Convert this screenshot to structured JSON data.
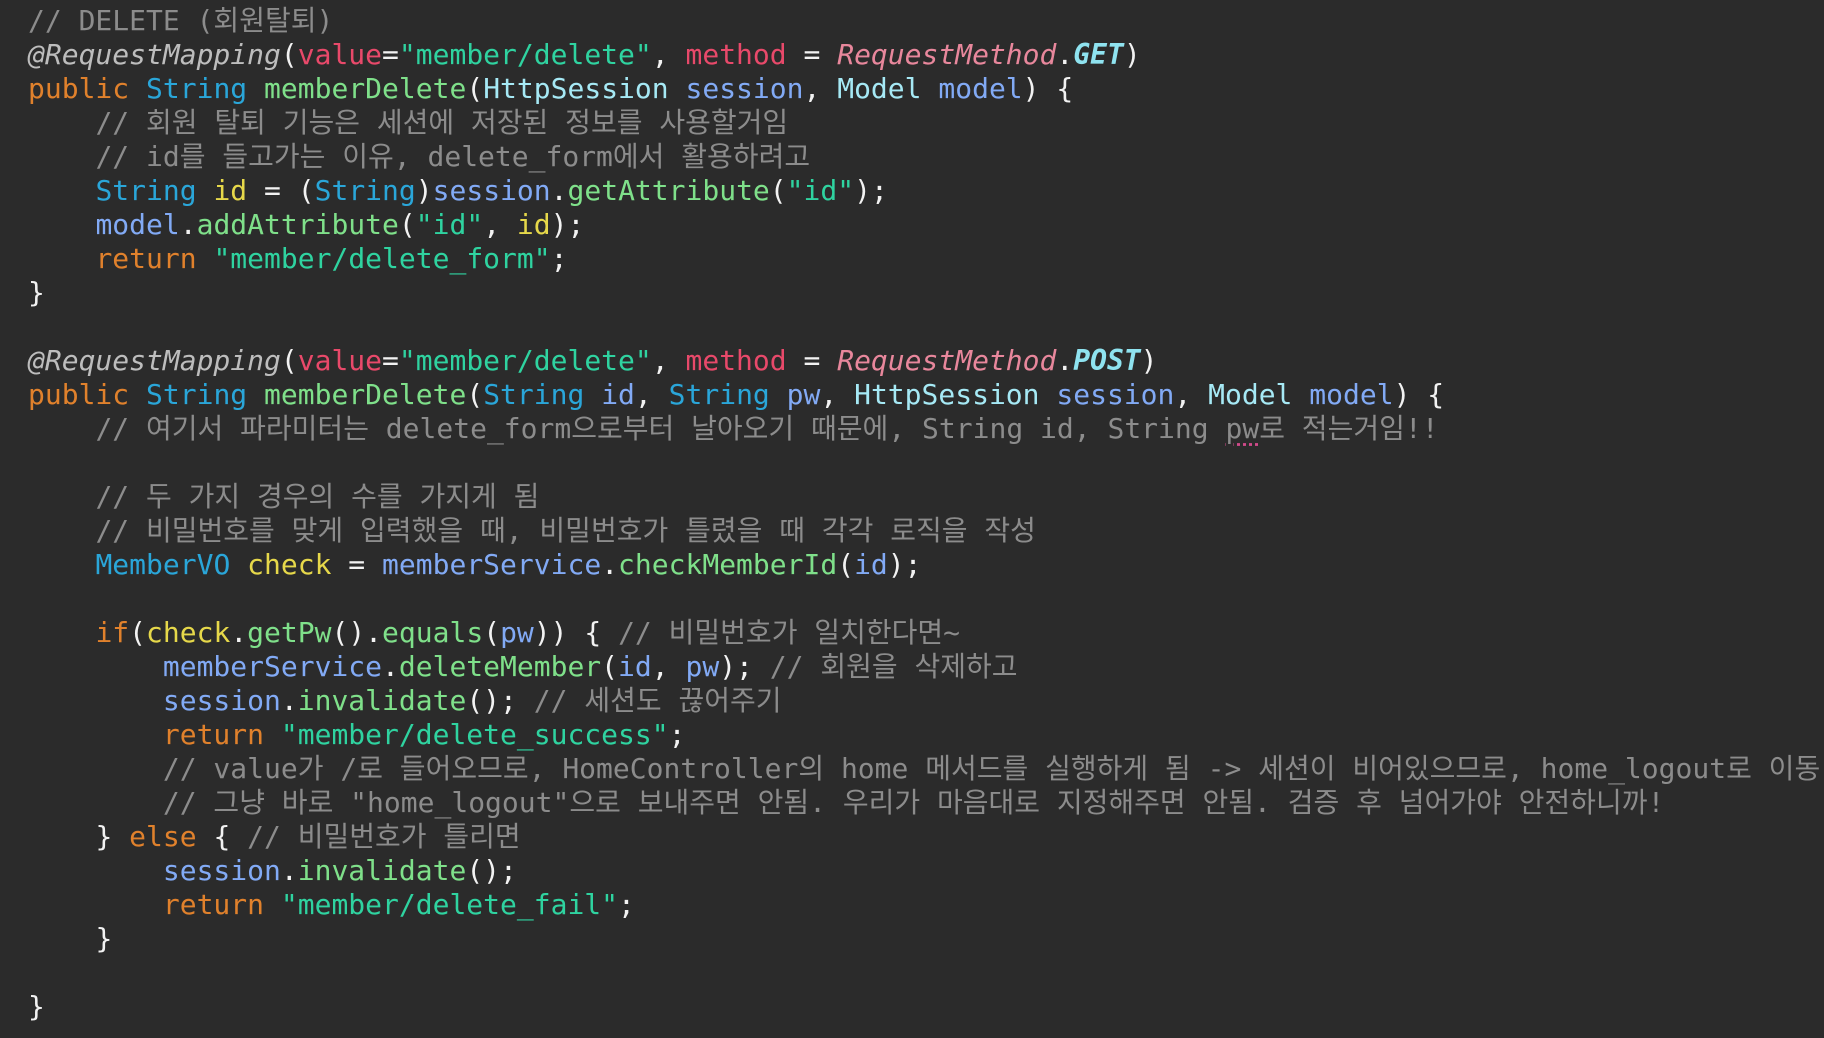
{
  "editor": {
    "lines": [
      [
        {
          "t": "// DELETE (회원탈퇴)",
          "c": "comment"
        }
      ],
      [
        {
          "t": "@RequestMapping",
          "c": "anno"
        },
        {
          "t": "(",
          "c": "punct"
        },
        {
          "t": "value",
          "c": "attr"
        },
        {
          "t": "=",
          "c": "punct"
        },
        {
          "t": "\"member/delete\"",
          "c": "string"
        },
        {
          "t": ", ",
          "c": "punct"
        },
        {
          "t": "method",
          "c": "attr"
        },
        {
          "t": " = ",
          "c": "punct"
        },
        {
          "t": "RequestMethod",
          "c": "enumCls"
        },
        {
          "t": ".",
          "c": "punct"
        },
        {
          "t": "GET",
          "c": "enumVal"
        },
        {
          "t": ")",
          "c": "punct"
        }
      ],
      [
        {
          "t": "public ",
          "c": "keyword"
        },
        {
          "t": "String ",
          "c": "type"
        },
        {
          "t": "memberDelete",
          "c": "method"
        },
        {
          "t": "(",
          "c": "punct"
        },
        {
          "t": "HttpSession ",
          "c": "typeLight"
        },
        {
          "t": "session",
          "c": "var"
        },
        {
          "t": ", ",
          "c": "punct"
        },
        {
          "t": "Model ",
          "c": "typeLight"
        },
        {
          "t": "model",
          "c": "var"
        },
        {
          "t": ") {",
          "c": "punct"
        }
      ],
      [
        {
          "t": "    ",
          "c": "plain"
        },
        {
          "t": "// 회원 탈퇴 기능은 세션에 저장된 정보를 사용할거임",
          "c": "comment"
        }
      ],
      [
        {
          "t": "    ",
          "c": "plain"
        },
        {
          "t": "// id를 들고가는 이유, delete_form에서 활용하려고",
          "c": "comment"
        }
      ],
      [
        {
          "t": "    ",
          "c": "plain"
        },
        {
          "t": "String ",
          "c": "type"
        },
        {
          "t": "id",
          "c": "param"
        },
        {
          "t": " = (",
          "c": "punct"
        },
        {
          "t": "String",
          "c": "type"
        },
        {
          "t": ")",
          "c": "punct"
        },
        {
          "t": "session",
          "c": "var"
        },
        {
          "t": ".",
          "c": "punct"
        },
        {
          "t": "getAttribute",
          "c": "method"
        },
        {
          "t": "(",
          "c": "punct"
        },
        {
          "t": "\"id\"",
          "c": "string"
        },
        {
          "t": ");",
          "c": "punct"
        }
      ],
      [
        {
          "t": "    ",
          "c": "plain"
        },
        {
          "t": "model",
          "c": "var"
        },
        {
          "t": ".",
          "c": "punct"
        },
        {
          "t": "addAttribute",
          "c": "method"
        },
        {
          "t": "(",
          "c": "punct"
        },
        {
          "t": "\"id\"",
          "c": "string"
        },
        {
          "t": ", ",
          "c": "punct"
        },
        {
          "t": "id",
          "c": "param"
        },
        {
          "t": ");",
          "c": "punct"
        }
      ],
      [
        {
          "t": "    ",
          "c": "plain"
        },
        {
          "t": "return ",
          "c": "keyword"
        },
        {
          "t": "\"member/delete_form\"",
          "c": "string"
        },
        {
          "t": ";",
          "c": "punct"
        }
      ],
      [
        {
          "t": "}",
          "c": "punct"
        }
      ],
      [
        {
          "t": "",
          "c": "plain"
        }
      ],
      [
        {
          "t": "@RequestMapping",
          "c": "anno"
        },
        {
          "t": "(",
          "c": "punct"
        },
        {
          "t": "value",
          "c": "attr"
        },
        {
          "t": "=",
          "c": "punct"
        },
        {
          "t": "\"member/delete\"",
          "c": "string"
        },
        {
          "t": ", ",
          "c": "punct"
        },
        {
          "t": "method",
          "c": "attr"
        },
        {
          "t": " = ",
          "c": "punct"
        },
        {
          "t": "RequestMethod",
          "c": "enumCls"
        },
        {
          "t": ".",
          "c": "punct"
        },
        {
          "t": "POST",
          "c": "enumVal"
        },
        {
          "t": ")",
          "c": "punct"
        }
      ],
      [
        {
          "t": "public ",
          "c": "keyword"
        },
        {
          "t": "String ",
          "c": "type"
        },
        {
          "t": "memberDelete",
          "c": "method"
        },
        {
          "t": "(",
          "c": "punct"
        },
        {
          "t": "String ",
          "c": "type"
        },
        {
          "t": "id",
          "c": "var"
        },
        {
          "t": ", ",
          "c": "punct"
        },
        {
          "t": "String ",
          "c": "type"
        },
        {
          "t": "pw",
          "c": "var"
        },
        {
          "t": ", ",
          "c": "punct"
        },
        {
          "t": "HttpSession ",
          "c": "typeLight"
        },
        {
          "t": "session",
          "c": "var"
        },
        {
          "t": ", ",
          "c": "punct"
        },
        {
          "t": "Model ",
          "c": "typeLight"
        },
        {
          "t": "model",
          "c": "var"
        },
        {
          "t": ") {",
          "c": "punct"
        }
      ],
      [
        {
          "t": "    ",
          "c": "plain"
        },
        {
          "t": "// 여기서 파라미터는 delete_form으로부터 날아오기 때문에, String id, String ",
          "c": "comment"
        },
        {
          "t": "pw",
          "c": "comment",
          "squiggle": true
        },
        {
          "t": "로 적는거임!!",
          "c": "comment"
        }
      ],
      [
        {
          "t": "",
          "c": "plain"
        }
      ],
      [
        {
          "t": "    ",
          "c": "plain"
        },
        {
          "t": "// 두 가지 경우의 수를 가지게 됨",
          "c": "comment"
        }
      ],
      [
        {
          "t": "    ",
          "c": "plain"
        },
        {
          "t": "// 비밀번호를 맞게 입력했을 때, 비밀번호가 틀렸을 때 각각 로직을 작성",
          "c": "comment"
        }
      ],
      [
        {
          "t": "    ",
          "c": "plain"
        },
        {
          "t": "MemberVO ",
          "c": "type"
        },
        {
          "t": "check",
          "c": "param"
        },
        {
          "t": " = ",
          "c": "punct"
        },
        {
          "t": "memberService",
          "c": "var"
        },
        {
          "t": ".",
          "c": "punct"
        },
        {
          "t": "checkMemberId",
          "c": "method"
        },
        {
          "t": "(",
          "c": "punct"
        },
        {
          "t": "id",
          "c": "var"
        },
        {
          "t": ");",
          "c": "punct"
        }
      ],
      [
        {
          "t": "",
          "c": "plain"
        }
      ],
      [
        {
          "t": "    ",
          "c": "plain"
        },
        {
          "t": "if",
          "c": "keyword"
        },
        {
          "t": "(",
          "c": "punct"
        },
        {
          "t": "check",
          "c": "param"
        },
        {
          "t": ".",
          "c": "punct"
        },
        {
          "t": "getPw",
          "c": "method"
        },
        {
          "t": "().",
          "c": "punct"
        },
        {
          "t": "equals",
          "c": "method"
        },
        {
          "t": "(",
          "c": "punct"
        },
        {
          "t": "pw",
          "c": "var"
        },
        {
          "t": ")) { ",
          "c": "punct"
        },
        {
          "t": "// 비밀번호가 일치한다면~",
          "c": "comment"
        }
      ],
      [
        {
          "t": "        ",
          "c": "plain"
        },
        {
          "t": "memberService",
          "c": "var"
        },
        {
          "t": ".",
          "c": "punct"
        },
        {
          "t": "deleteMember",
          "c": "method"
        },
        {
          "t": "(",
          "c": "punct"
        },
        {
          "t": "id",
          "c": "var"
        },
        {
          "t": ", ",
          "c": "punct"
        },
        {
          "t": "pw",
          "c": "var"
        },
        {
          "t": "); ",
          "c": "punct"
        },
        {
          "t": "// 회원을 삭제하고",
          "c": "comment"
        }
      ],
      [
        {
          "t": "        ",
          "c": "plain"
        },
        {
          "t": "session",
          "c": "var"
        },
        {
          "t": ".",
          "c": "punct"
        },
        {
          "t": "invalidate",
          "c": "method"
        },
        {
          "t": "(); ",
          "c": "punct"
        },
        {
          "t": "// 세션도 끊어주기",
          "c": "comment"
        }
      ],
      [
        {
          "t": "        ",
          "c": "plain"
        },
        {
          "t": "return ",
          "c": "keyword"
        },
        {
          "t": "\"member/delete_success\"",
          "c": "string"
        },
        {
          "t": ";",
          "c": "punct"
        }
      ],
      [
        {
          "t": "        ",
          "c": "plain"
        },
        {
          "t": "// value가 /로 들어오므로, HomeController의 home 메서드를 실행하게 됨 -> 세션이 비어있으므로, home_logout로 이동",
          "c": "comment"
        }
      ],
      [
        {
          "t": "        ",
          "c": "plain"
        },
        {
          "t": "// 그냥 바로 \"home_logout\"으로 보내주면 안됨. 우리가 마음대로 지정해주면 안됨. 검증 후 넘어가야 안전하니까!",
          "c": "comment"
        }
      ],
      [
        {
          "t": "    ",
          "c": "plain"
        },
        {
          "t": "} ",
          "c": "punct"
        },
        {
          "t": "else",
          "c": "keyword"
        },
        {
          "t": " { ",
          "c": "punct"
        },
        {
          "t": "// 비밀번호가 틀리면",
          "c": "comment"
        }
      ],
      [
        {
          "t": "        ",
          "c": "plain"
        },
        {
          "t": "session",
          "c": "var"
        },
        {
          "t": ".",
          "c": "punct"
        },
        {
          "t": "invalidate",
          "c": "method"
        },
        {
          "t": "();",
          "c": "punct"
        }
      ],
      [
        {
          "t": "        ",
          "c": "plain"
        },
        {
          "t": "return ",
          "c": "keyword"
        },
        {
          "t": "\"member/delete_fail\"",
          "c": "string"
        },
        {
          "t": ";",
          "c": "punct"
        }
      ],
      [
        {
          "t": "    ",
          "c": "plain"
        },
        {
          "t": "}",
          "c": "punct"
        }
      ],
      [
        {
          "t": "",
          "c": "plain"
        }
      ],
      [
        {
          "t": "}",
          "c": "punct"
        }
      ]
    ]
  }
}
